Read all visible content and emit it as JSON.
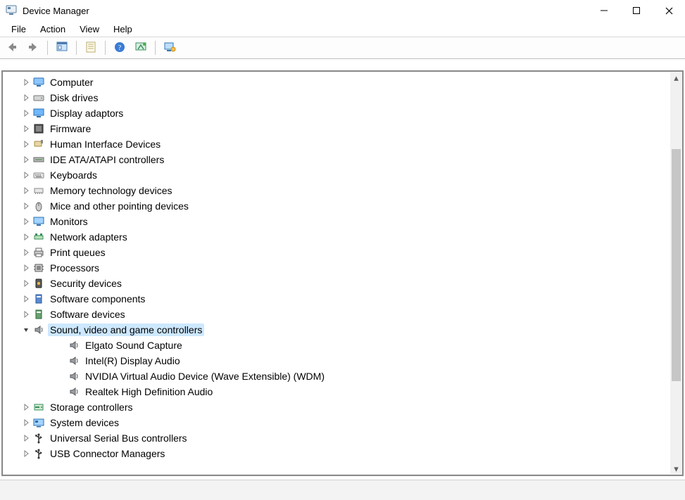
{
  "window": {
    "title": "Device Manager"
  },
  "menu": {
    "items": [
      "File",
      "Action",
      "View",
      "Help"
    ]
  },
  "toolbar": {
    "buttons": [
      {
        "name": "back",
        "icon": "arrow-left"
      },
      {
        "name": "forward",
        "icon": "arrow-right"
      },
      {
        "sep": true
      },
      {
        "name": "show-hide-tree",
        "icon": "console-tree"
      },
      {
        "sep": true
      },
      {
        "name": "properties",
        "icon": "properties"
      },
      {
        "sep": true
      },
      {
        "name": "help",
        "icon": "help"
      },
      {
        "name": "scan-hardware",
        "icon": "scan"
      },
      {
        "sep": true
      },
      {
        "name": "monitor",
        "icon": "monitor"
      }
    ]
  },
  "tree": {
    "nodes": [
      {
        "label": "Computer",
        "icon": "computer",
        "state": "collapsed"
      },
      {
        "label": "Disk drives",
        "icon": "disk",
        "state": "collapsed"
      },
      {
        "label": "Display adaptors",
        "icon": "display",
        "state": "collapsed"
      },
      {
        "label": "Firmware",
        "icon": "firmware",
        "state": "collapsed"
      },
      {
        "label": "Human Interface Devices",
        "icon": "hid",
        "state": "collapsed"
      },
      {
        "label": "IDE ATA/ATAPI controllers",
        "icon": "ide",
        "state": "collapsed"
      },
      {
        "label": "Keyboards",
        "icon": "keyboard",
        "state": "collapsed"
      },
      {
        "label": "Memory technology devices",
        "icon": "memory",
        "state": "collapsed"
      },
      {
        "label": "Mice and other pointing devices",
        "icon": "mouse",
        "state": "collapsed"
      },
      {
        "label": "Monitors",
        "icon": "monitor",
        "state": "collapsed"
      },
      {
        "label": "Network adapters",
        "icon": "network",
        "state": "collapsed"
      },
      {
        "label": "Print queues",
        "icon": "printer",
        "state": "collapsed"
      },
      {
        "label": "Processors",
        "icon": "cpu",
        "state": "collapsed"
      },
      {
        "label": "Security devices",
        "icon": "security",
        "state": "collapsed"
      },
      {
        "label": "Software components",
        "icon": "swcomp",
        "state": "collapsed"
      },
      {
        "label": "Software devices",
        "icon": "swdev",
        "state": "collapsed"
      },
      {
        "label": "Sound, video and game controllers",
        "icon": "speaker",
        "state": "expanded",
        "selected": true,
        "children": [
          {
            "label": "Elgato Sound Capture",
            "icon": "speaker"
          },
          {
            "label": "Intel(R) Display Audio",
            "icon": "speaker"
          },
          {
            "label": "NVIDIA Virtual Audio Device (Wave Extensible) (WDM)",
            "icon": "speaker"
          },
          {
            "label": "Realtek High Definition Audio",
            "icon": "speaker"
          }
        ]
      },
      {
        "label": "Storage controllers",
        "icon": "storage",
        "state": "collapsed"
      },
      {
        "label": "System devices",
        "icon": "system",
        "state": "collapsed"
      },
      {
        "label": "Universal Serial Bus controllers",
        "icon": "usb",
        "state": "collapsed"
      },
      {
        "label": "USB Connector Managers",
        "icon": "usb",
        "state": "collapsed"
      }
    ]
  }
}
